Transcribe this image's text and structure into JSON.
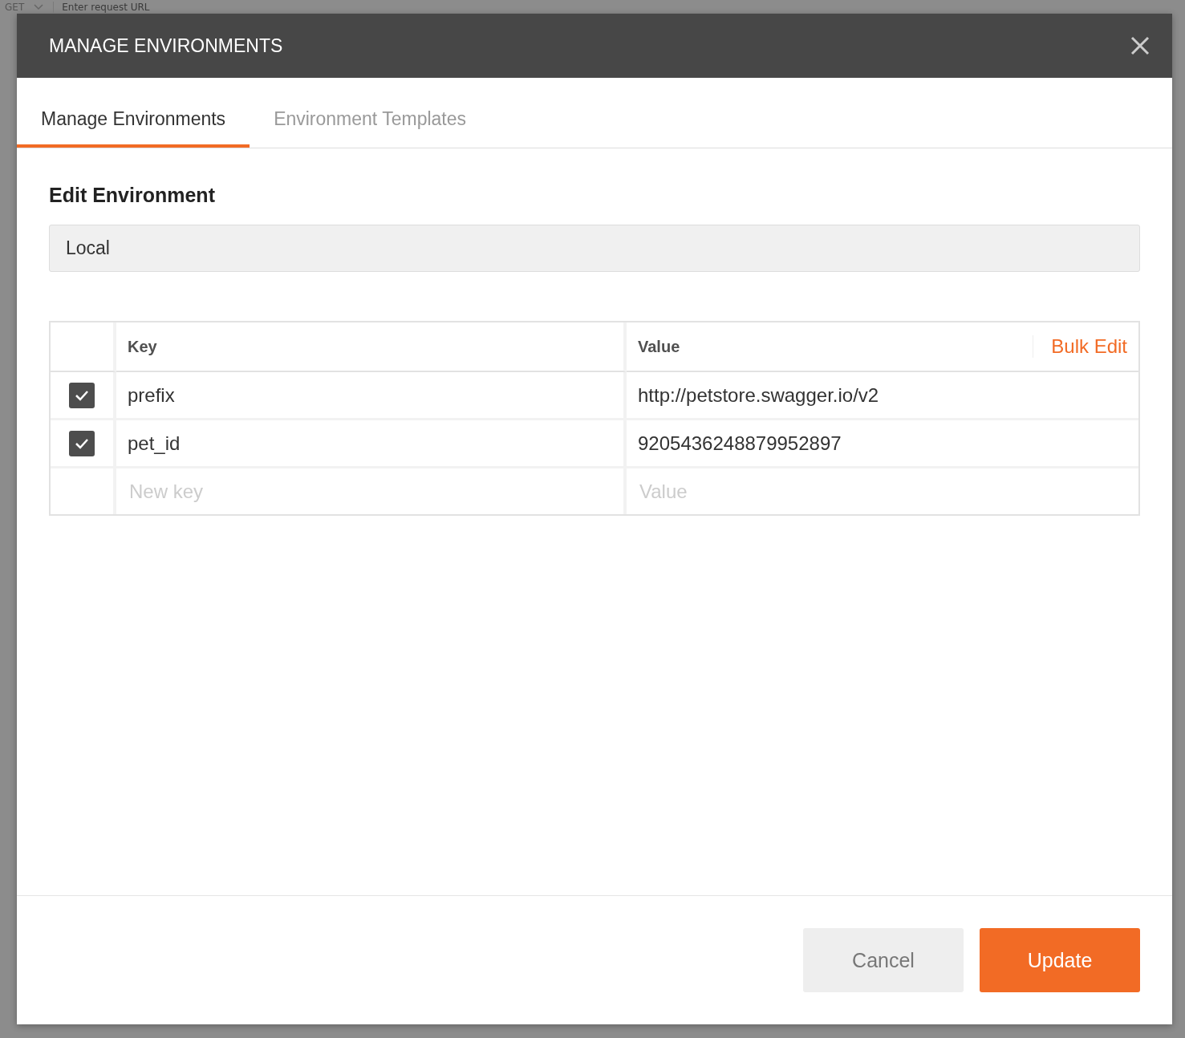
{
  "background": {
    "method": "GET",
    "url_placeholder": "Enter request URL"
  },
  "dialog": {
    "title": "MANAGE ENVIRONMENTS",
    "tabs": [
      {
        "label": "Manage Environments",
        "selected": true
      },
      {
        "label": "Environment Templates",
        "selected": false
      }
    ],
    "section_title": "Edit Environment",
    "environment_name": "Local",
    "table": {
      "columns": [
        "Key",
        "Value"
      ],
      "bulk_edit": "Bulk Edit",
      "rows": [
        {
          "enabled": true,
          "key": "prefix",
          "value": "http://petstore.swagger.io/v2"
        },
        {
          "enabled": true,
          "key": "pet_id",
          "value": "9205436248879952897"
        }
      ],
      "new_row": {
        "key_placeholder": "New key",
        "value_placeholder": "Value"
      }
    },
    "buttons": [
      {
        "label": "Cancel",
        "kind": "secondary"
      },
      {
        "label": "Update",
        "kind": "primary"
      }
    ]
  }
}
